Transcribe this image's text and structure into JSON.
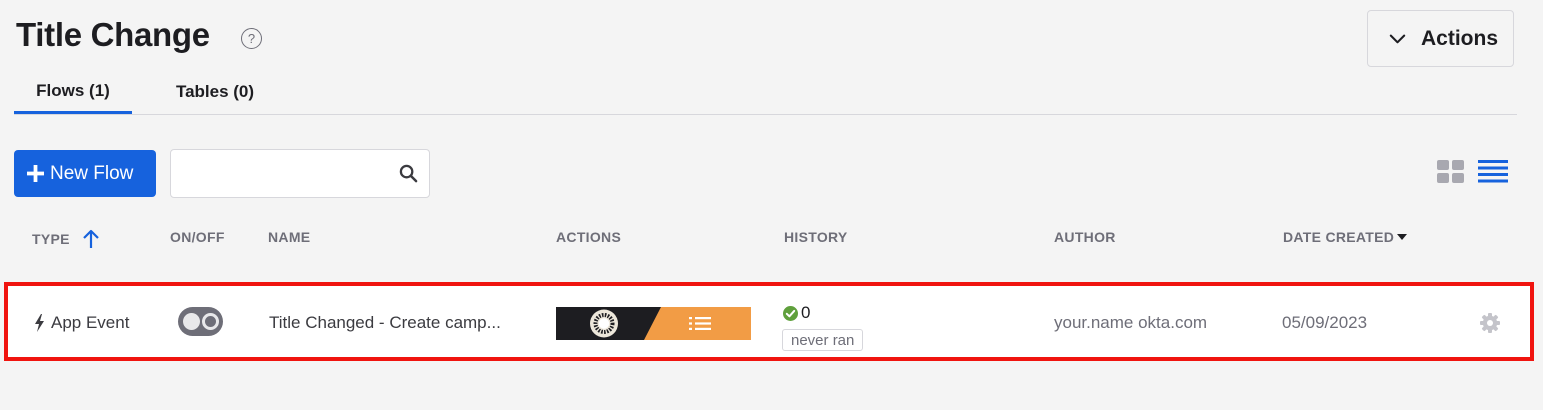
{
  "header": {
    "title": "Title Change",
    "help_icon": "help-circle-icon",
    "actions_label": "Actions"
  },
  "tabs": [
    {
      "label": "Flows (1)",
      "active": true
    },
    {
      "label": "Tables (0)",
      "active": false
    }
  ],
  "toolbar": {
    "new_flow_label": "New Flow",
    "search_value": "",
    "search_placeholder": ""
  },
  "columns": {
    "type": "TYPE",
    "onoff": "ON/OFF",
    "name": "NAME",
    "actions": "ACTIONS",
    "history": "HISTORY",
    "author": "AUTHOR",
    "date_created": "DATE CREATED"
  },
  "rows": [
    {
      "type": "App Event",
      "enabled": false,
      "name": "Title Changed - Create camp...",
      "history_count": "0",
      "history_status": "never ran",
      "author": "your.name okta.com",
      "date_created": "05/09/2023"
    }
  ],
  "colors": {
    "accent": "#1662dd",
    "highlight_border": "#f0140f",
    "actions_dark": "#1d1d21",
    "actions_orange": "#f29c45",
    "success": "#5fa03c"
  }
}
